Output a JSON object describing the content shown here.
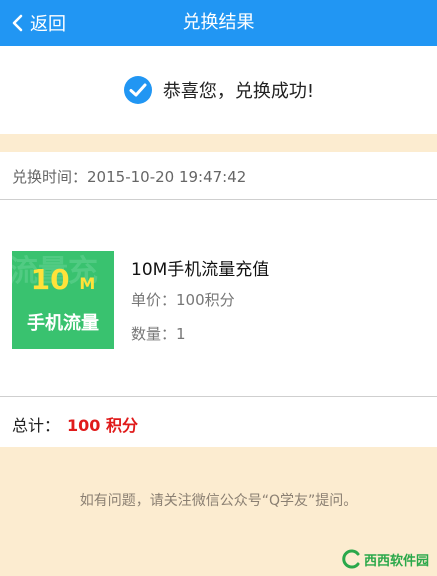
{
  "header": {
    "back_label": "返回",
    "title": "兑换结果"
  },
  "success": {
    "message": "恭喜您，兑换成功!"
  },
  "exchange": {
    "time_label": "兑换时间：",
    "time_value": "2015-10-20 19:47:42"
  },
  "product": {
    "thumb_big": "10",
    "thumb_unit": "M",
    "thumb_small": "手机流量",
    "thumb_bg": "流量充",
    "name": "10M手机流量充值",
    "price_label": "单价：",
    "price_value": "100积分",
    "qty_label": "数量：",
    "qty_value": "1"
  },
  "total": {
    "label": "总计：",
    "value": "100 积分"
  },
  "help": {
    "text": "如有问题，请关注微信公众号“Q学友”提问。"
  },
  "watermark": {
    "text": "西西软件园"
  },
  "colors": {
    "header": "#2196f3",
    "accent_green": "#39c26f",
    "total_red": "#e01b1b",
    "band": "#fcecd0"
  },
  "icons": {
    "back": "chevron-left-icon",
    "success": "check-circle-icon"
  }
}
